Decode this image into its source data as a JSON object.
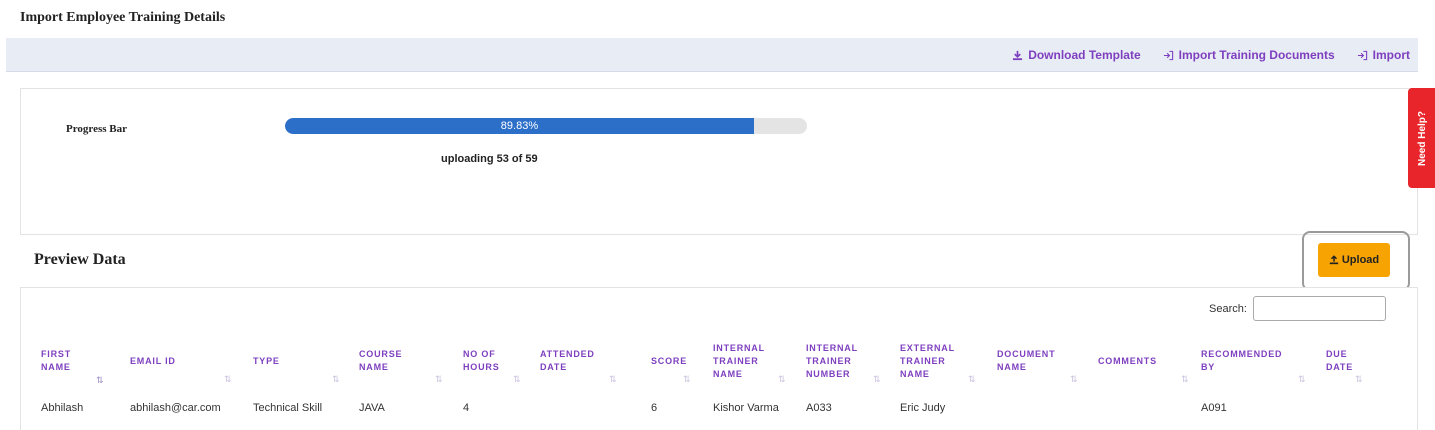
{
  "page": {
    "title": "Import Employee Training Details"
  },
  "toolbar": {
    "download_template": "Download Template",
    "import_training_documents": "Import Training Documents",
    "import": "Import"
  },
  "progress": {
    "label": "Progress Bar",
    "percent_text": "89.83%",
    "fraction": 0.8983,
    "status": "uploading 53 of 59"
  },
  "help_tab": {
    "label": "Need Help?"
  },
  "preview": {
    "title": "Preview Data",
    "upload_label": "Upload",
    "search_label": "Search:",
    "search_value": ""
  },
  "table": {
    "columns": [
      "FIRST\nNAME",
      "EMAIL ID",
      "TYPE",
      "COURSE\nNAME",
      "NO OF\nHOURS",
      "ATTENDED\nDATE",
      "SCORE",
      "INTERNAL\nTRAINER\nNAME",
      "INTERNAL\nTRAINER\nNUMBER",
      "EXTERNAL\nTRAINER\nNAME",
      "DOCUMENT\nNAME",
      "COMMENTS",
      "RECOMMENDED\nBY",
      "DUE\nDATE"
    ],
    "rows": [
      [
        "Abhilash",
        "abhilash@car.com",
        "Technical Skill",
        "JAVA",
        "4",
        "",
        "6",
        "Kishor Varma",
        "A033",
        "Eric Judy",
        "",
        "",
        "A091",
        ""
      ]
    ]
  },
  "colors": {
    "accent_purple": "#7e3fbf",
    "progress_blue": "#2b6fc9",
    "upload_orange": "#f7a402",
    "help_red": "#e8252a"
  }
}
